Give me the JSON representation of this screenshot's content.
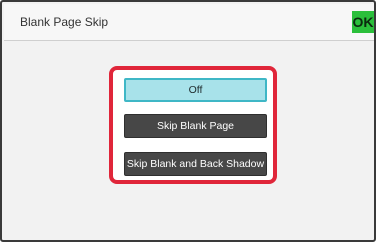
{
  "window": {
    "title": "Blank Page Skip",
    "ok_label": "OK"
  },
  "options": {
    "items": [
      {
        "label": "Off",
        "selected": true
      },
      {
        "label": "Skip Blank Page",
        "selected": false
      },
      {
        "label": "Skip Blank and Back Shadow",
        "selected": false
      }
    ]
  },
  "colors": {
    "ok_button": "#2bbf3b",
    "highlight_border": "#e0263a",
    "selected_option_bg": "#a8e2ea",
    "option_bg": "#474747"
  }
}
